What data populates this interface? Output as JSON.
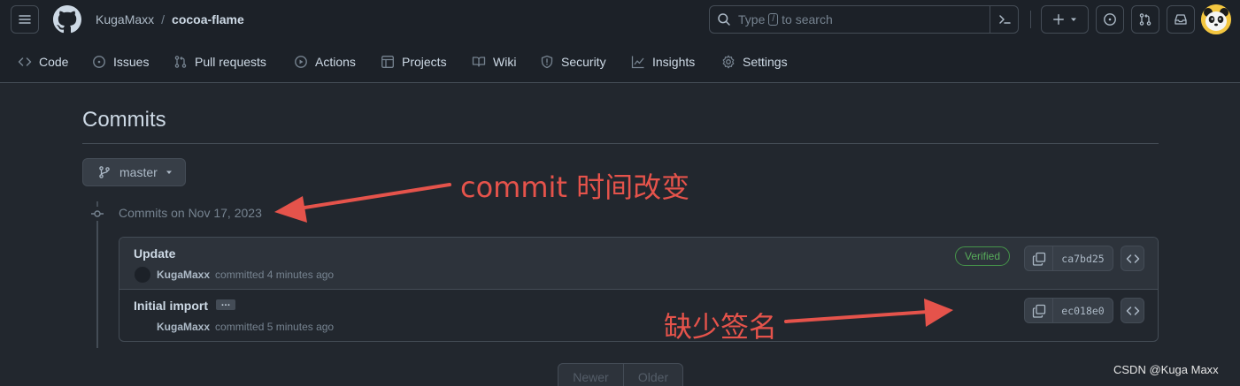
{
  "header": {
    "owner": "KugaMaxx",
    "separator": "/",
    "repo": "cocoa-flame",
    "search_prefix": "Type",
    "search_key": "/",
    "search_suffix": "to search"
  },
  "nav": {
    "tabs": [
      {
        "label": "Code",
        "icon": "code-icon"
      },
      {
        "label": "Issues",
        "icon": "issue-icon"
      },
      {
        "label": "Pull requests",
        "icon": "pull-request-icon"
      },
      {
        "label": "Actions",
        "icon": "play-icon"
      },
      {
        "label": "Projects",
        "icon": "table-icon"
      },
      {
        "label": "Wiki",
        "icon": "book-icon"
      },
      {
        "label": "Security",
        "icon": "shield-icon"
      },
      {
        "label": "Insights",
        "icon": "graph-icon"
      },
      {
        "label": "Settings",
        "icon": "gear-icon"
      }
    ]
  },
  "main": {
    "title": "Commits",
    "branch": "master",
    "day_header": "Commits on Nov 17, 2023",
    "commits": [
      {
        "title": "Update",
        "author": "KugaMaxx",
        "time": "committed 4 minutes ago",
        "badge": "Verified",
        "sha": "ca7bd25"
      },
      {
        "title": "Initial import",
        "ellipsis": "…",
        "author": "KugaMaxx",
        "time": "committed 5 minutes ago",
        "sha": "ec018e0"
      }
    ],
    "pager": {
      "newer": "Newer",
      "older": "Older"
    }
  },
  "annotations": {
    "arrow_1_label": "commit 时间改变",
    "arrow_2_label": "缺少签名",
    "color": "#e5534b"
  },
  "watermark": "CSDN @Kuga Maxx"
}
